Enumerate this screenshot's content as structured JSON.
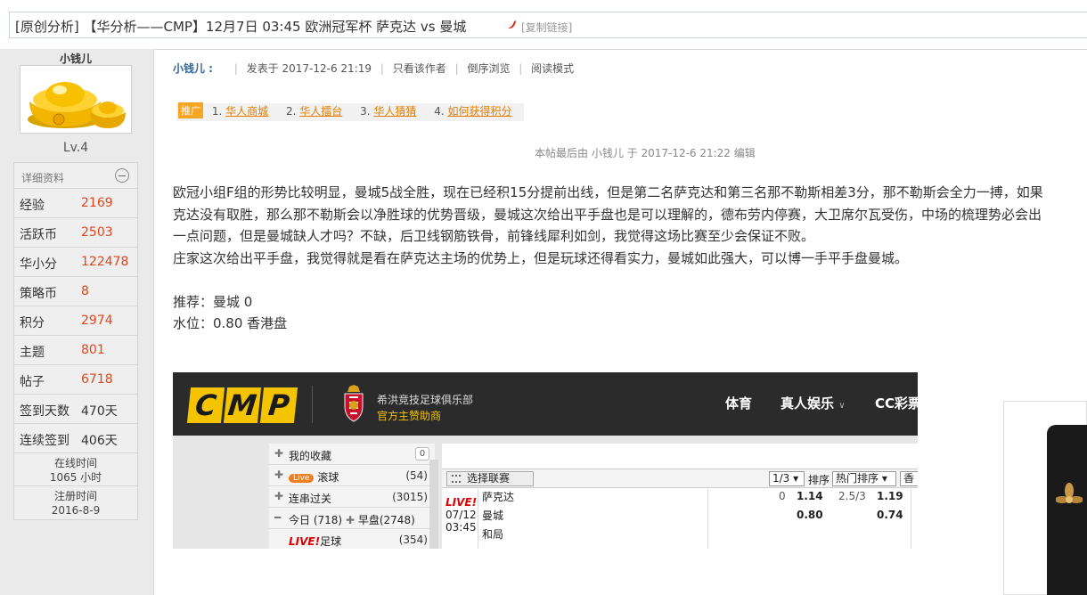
{
  "thread": {
    "title": "[原创分析] 【华分析——CMP】12月7日 03:45 欧洲冠军杯 萨克达 vs 曼城",
    "copy_link": "[复制链接]"
  },
  "profile": {
    "username": "小钱儿",
    "level": "Lv.4",
    "details_label": "详细资料",
    "stats": [
      {
        "key": "经验",
        "value": "2169"
      },
      {
        "key": "活跃币",
        "value": "2503"
      },
      {
        "key": "华小分",
        "value": "122478"
      },
      {
        "key": "策略币",
        "value": "8"
      },
      {
        "key": "积分",
        "value": "2974"
      },
      {
        "key": "主题",
        "value": "801"
      },
      {
        "key": "帖子",
        "value": "6718"
      },
      {
        "key": "签到天数",
        "value": "470天"
      },
      {
        "key": "连续签到",
        "value": "406天"
      }
    ],
    "online_label": "在线时间",
    "online_value": "1065 小时",
    "reg_label": "注册时间",
    "reg_value": "2016-8-9"
  },
  "post": {
    "author": "小钱儿 :",
    "posted": "发表于 2017-12-6 21:19",
    "author_only": "只看该作者",
    "reverse": "倒序浏览",
    "read_mode": "阅读模式",
    "promo_badge": "推广",
    "promo_links": [
      {
        "num": "1.",
        "text": "华人商城"
      },
      {
        "num": "2.",
        "text": "华人擂台"
      },
      {
        "num": "3.",
        "text": "华人猜猜"
      },
      {
        "num": "4.",
        "text": "如何获得积分"
      }
    ],
    "edited": "本帖最后由 小钱儿 于 2017-12-6 21:22 编辑",
    "paragraphs": [
      "欧冠小组F组的形势比较明显，曼城5战全胜，现在已经积15分提前出线，但是第二名萨克达和第三名那不勒斯相差3分，那不勒斯会全力一搏，如果",
      "克达没有取胜，那么那不勒斯会以净胜球的优势晋级，曼城这次给出平手盘也是可以理解的，德布劳内停赛，大卫席尔瓦受伤，中场的梳理势必会出",
      "一点问题，但是曼城缺人才吗？不缺，后卫线钢筋铁骨，前锋线犀利如剑，我觉得这场比赛至少会保证不败。",
      "庄家这次给出平手盘，我觉得就是看在萨克达主场的优势上，但是玩球还得看实力，曼城如此强大，可以博一手平手盘曼城。",
      "",
      "推荐：曼城 0",
      "水位：0.80 香港盘"
    ]
  },
  "cmp": {
    "logo": [
      "C",
      "M",
      "P"
    ],
    "club": "希洪竞技足球俱乐部",
    "sponsor": "官方主赞助商",
    "nav": [
      "体育",
      "真人娱乐",
      "CC彩票"
    ],
    "side": [
      {
        "label": "我的收藏",
        "count": "0"
      },
      {
        "live": "Live",
        "label": "滚球",
        "count": "(54)"
      },
      {
        "label": "连串过关",
        "count": "(3015)"
      },
      {
        "label": "今日",
        "count": "(718)",
        "label2": "早盘",
        "count2": "(2748)"
      },
      {
        "live_text": "LIVE!",
        "label": "足球",
        "count": "(354)"
      }
    ],
    "select_league": "选择联赛",
    "odds_dd": "1/3",
    "sort_label": "排序",
    "sort_dd": "热门排序",
    "more_dd": "香",
    "match": {
      "live": "LIVE!",
      "date": "07/12",
      "time": "03:45",
      "home": "萨克达",
      "away": "曼城",
      "draw": "和局",
      "hcap1": "0",
      "odds1": "1.14",
      "ou": "2.5/3",
      "odds2": "1.19",
      "odds3": "0.80",
      "odds4": "0.74"
    }
  }
}
